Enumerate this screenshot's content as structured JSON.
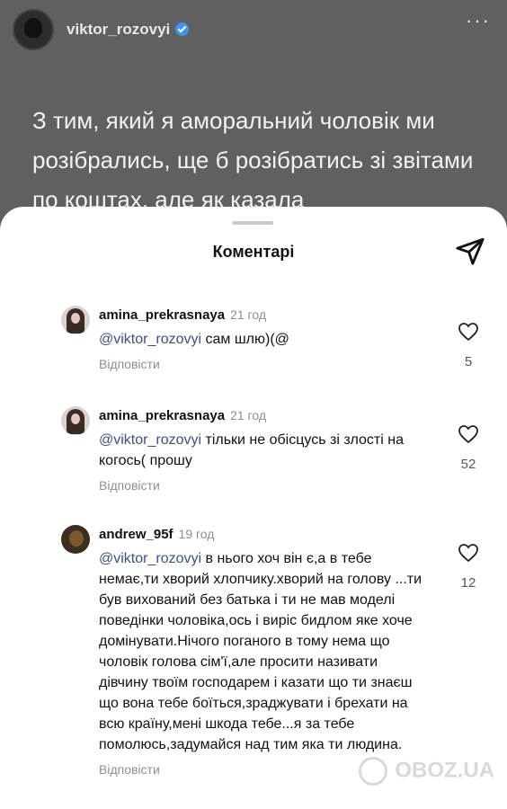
{
  "story": {
    "username": "viktor_rozovyi",
    "text": "З тим, який я аморальний чоловік ми розібрались, ще б розібратись зі звітами по коштах, але як казала"
  },
  "sheet": {
    "title": "Коментарі"
  },
  "comments": [
    {
      "username": "amina_prekrasnaya",
      "time": "21 год",
      "mention": "@viktor_rozovyi",
      "text": " сам шлю)(@",
      "reply_label": "Відповісти",
      "likes": "5",
      "avatar": "avatar-photo-girl"
    },
    {
      "username": "amina_prekrasnaya",
      "time": "21 год",
      "mention": "@viktor_rozovyi",
      "text": " тільки не обісцусь зі злості на когось( прошу",
      "reply_label": "Відповісти",
      "likes": "52",
      "avatar": "avatar-photo-girl"
    },
    {
      "username": "andrew_95f",
      "time": "19 год",
      "mention": "@viktor_rozovyi",
      "text": " в нього хоч він є,а в тебе немає,ти хворий хлопчику.хворий на голову ...ти був вихований без батька і ти не мав моделі поведінки чоловіка,ось і виріс бидлом яке хоче домінувати.Нічого поганого в тому нема що чоловік голова сім'ї,але просити називати дівчину твоїм господарем і казати що ти знаєш що вона тебе боїться,зраджувати і брехати на всю країну,мені шкода тебе...я за тебе помолюсь,задумайся над тим яка ти людина.",
      "reply_label": "Відповісти",
      "likes": "12",
      "avatar": "avatar-photo-dark"
    }
  ],
  "watermark": "OBOZ.UA",
  "colors": {
    "mention": "#375383",
    "muted": "#8e8e8e",
    "verified": "#3897f0"
  }
}
